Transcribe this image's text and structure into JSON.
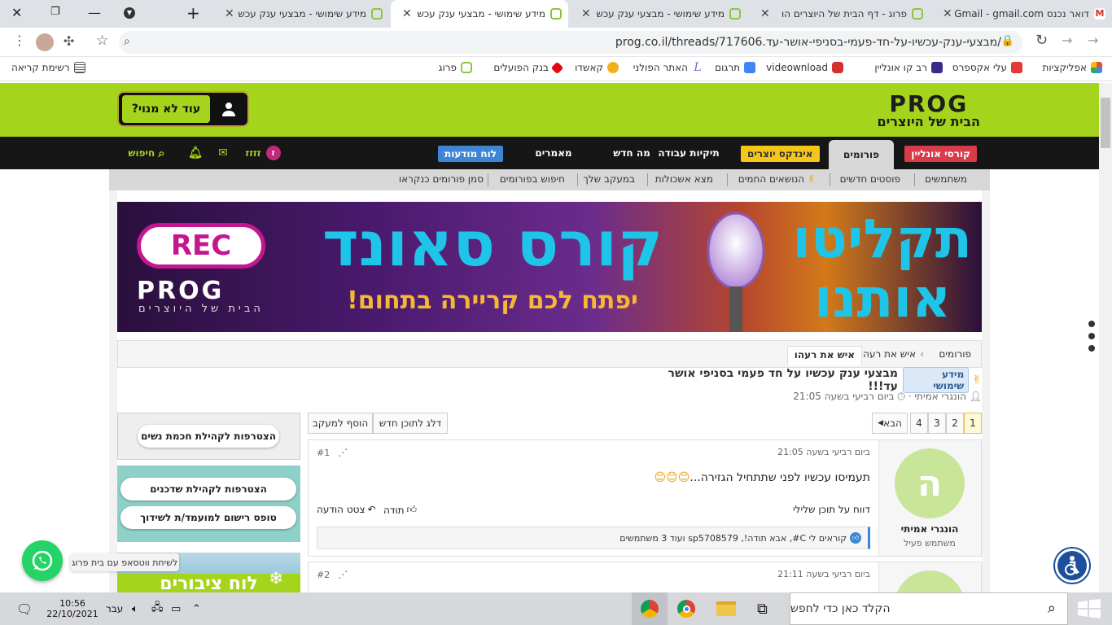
{
  "browser": {
    "tabs": [
      {
        "title": "דואר נכנס Gmail - gmail.com",
        "active": false
      },
      {
        "title": "פרוג - דף הבית של היוצרים הו",
        "active": false
      },
      {
        "title": "מידע שימושי - מבצעי ענק עכש",
        "active": false
      },
      {
        "title": "מידע שימושי - מבצעי ענק עכש",
        "active": true
      },
      {
        "title": "מידע שימושי - מבצעי ענק עכש",
        "active": false
      }
    ],
    "new_tab": "+",
    "url": "prog.co.il/threads/717606.מבצעי-ענק-עכשיו-על-חד-פעמי-בסניפי-אושר-עד/",
    "bookmarks": [
      {
        "label": "אפליקציות",
        "color": "#e84c3d"
      },
      {
        "label": "עלי אקספרס",
        "color": "#e53935"
      },
      {
        "label": "רב קו אונליין",
        "color": "#3c2a8a"
      },
      {
        "label": "videownload",
        "color": "#d32f2f"
      },
      {
        "label": "תרגום",
        "color": "#4285f4"
      },
      {
        "label": "האתר הפולני",
        "color": "#7b61c9"
      },
      {
        "label": "קאשדו",
        "color": "#f2b01e"
      },
      {
        "label": "בנק הפועלים",
        "color": "#e30613"
      },
      {
        "label": "פרוג",
        "color": "#8cc63f"
      }
    ],
    "reading_list": "רשימת קריאה"
  },
  "site": {
    "logo_text": "PROG",
    "logo_tagline": "הבית של היוצרים",
    "signup_label": "עוד לא מנוי?",
    "nav": [
      {
        "label": "קורסי אונליין",
        "style": "pill",
        "bg": "#d93b4a",
        "fg": "#ffffff"
      },
      {
        "label": "פורומים",
        "style": "tab-active"
      },
      {
        "label": "אינדקס יוצרים",
        "style": "pill",
        "bg": "#f5c518",
        "fg": "#333333"
      },
      {
        "label": "תיקיות עבודה",
        "style": "plain"
      },
      {
        "label": "מה חדש",
        "style": "plain"
      },
      {
        "label": "מאמרים",
        "style": "plain"
      },
      {
        "label": "לוח מודעות",
        "style": "pill",
        "bg": "#3d86d6",
        "fg": "#ffffff"
      }
    ],
    "user": {
      "initial": "ז",
      "name": "זזזז"
    },
    "search_label": "חיפוש",
    "subnav": [
      "משתמשים",
      "פוסטים חדשים",
      "הנושאים החמים",
      "מצא אשכולות",
      "במעקב שלך",
      "חיפוש בפורומים",
      "סמן פורומים כנקראו"
    ],
    "accent": "#a5d41d"
  },
  "banner": {
    "rec": "REC",
    "logo": "PROG",
    "tagline": "הבית של היוצרים",
    "headline": "קורס סאונד",
    "subline": "יפתח לכם קריירה בתחום!",
    "right_text": "תקליטו אותנו"
  },
  "breadcrumb": [
    "פורומים",
    "איש את רעהו",
    "איש את רעהו"
  ],
  "thread": {
    "emoji": "✌",
    "badge": "מידע שימושי",
    "title": "מבצעי ענק עכשיו על חד פעמי בסניפי אושר עד!!!",
    "author": "הונגרי אמיתי",
    "date": "ביום רביעי בשעה 21:05"
  },
  "pagination": {
    "pages": [
      "1",
      "2",
      "3",
      "4"
    ],
    "current": "1",
    "next": "הבא"
  },
  "actions": {
    "skip": "דלג לתוכן חדש",
    "watch": "הוסף למעקב"
  },
  "posts": [
    {
      "number": "#1",
      "date": "ביום רביעי בשעה 21:05",
      "body": "תעמיסו עכשיו לפני שתתחיל הגזירה...",
      "emojis": "😊😊😊",
      "report": "דווח על תוכן שלילי",
      "thanks": "תודה",
      "quote": "צטט הודעה",
      "reactions": "קוראים לי C#, אבא תודה!, sp5708579 ועוד 3 משתמשים",
      "user": {
        "initial": "ה",
        "name": "הונגרי אמיתי",
        "role": "משתמש פעיל"
      }
    },
    {
      "number": "#2",
      "date": "ביום רביעי בשעה 21:11"
    }
  ],
  "sidebar": {
    "join_women": "הצטרפות לקהילת חכמת נשים",
    "join_matchmakers": "הצטרפות לקהילת שדכנים",
    "register_form": "טופס רישום למועמד/ת לשידוך",
    "board_label": "לוח ציבורים"
  },
  "floating": {
    "whatsapp_tip": "לשיחת ווטסאפ עם בית פרוג"
  },
  "taskbar": {
    "search_placeholder": "הקלד כאן כדי לחפש",
    "time": "10:56",
    "date": "22/10/2021",
    "lang": "עבר"
  }
}
